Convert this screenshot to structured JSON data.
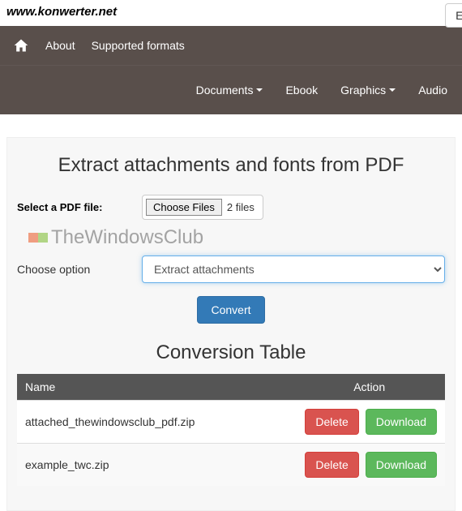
{
  "site_url": "www.konwerter.net",
  "lang_button": "Eng",
  "nav": {
    "about": "About",
    "supported": "Supported formats",
    "documents": "Documents",
    "ebook": "Ebook",
    "graphics": "Graphics",
    "audio": "Audio"
  },
  "page_title": "Extract attachments and fonts from PDF",
  "form": {
    "file_label": "Select a PDF file:",
    "choose_btn": "Choose Files",
    "file_count": "2 files",
    "option_label": "Choose option",
    "option_selected": "Extract attachments",
    "convert": "Convert"
  },
  "watermark": "TheWindowsClub",
  "table": {
    "title": "Conversion Table",
    "col_name": "Name",
    "col_action": "Action",
    "rows": [
      {
        "name": "attached_thewindowsclub_pdf.zip",
        "delete": "Delete",
        "download": "Download"
      },
      {
        "name": "example_twc.zip",
        "delete": "Delete",
        "download": "Download"
      }
    ]
  }
}
